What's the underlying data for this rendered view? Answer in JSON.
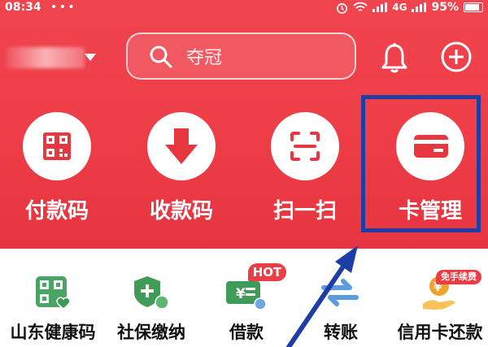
{
  "status_bar": {
    "time": "08:34",
    "dots": "• • •",
    "network": "4G",
    "battery": "95%"
  },
  "header": {
    "search": {
      "placeholder": "夺冠"
    }
  },
  "quick_actions": [
    {
      "label": "付款码",
      "icon": "qr-code-icon"
    },
    {
      "label": "收款码",
      "icon": "download-arrow-icon"
    },
    {
      "label": "扫一扫",
      "icon": "scan-icon"
    },
    {
      "label": "卡管理",
      "icon": "bank-card-icon"
    }
  ],
  "services": [
    {
      "label": "山东健康码",
      "icon": "health-code-icon"
    },
    {
      "label": "社保缴纳",
      "icon": "social-security-shield-icon"
    },
    {
      "label": "借款",
      "icon": "loan-card-icon",
      "badge": "HOT"
    },
    {
      "label": "转账",
      "icon": "transfer-icon"
    },
    {
      "label": "信用卡还款",
      "icon": "credit-card-repay-icon",
      "badge": "免手续费"
    }
  ],
  "colors": {
    "brand_red": "#ee3d47",
    "highlight_blue": "#1e3ea6",
    "accent_green": "#3f9b57",
    "accent_orange": "#f2a32c"
  }
}
